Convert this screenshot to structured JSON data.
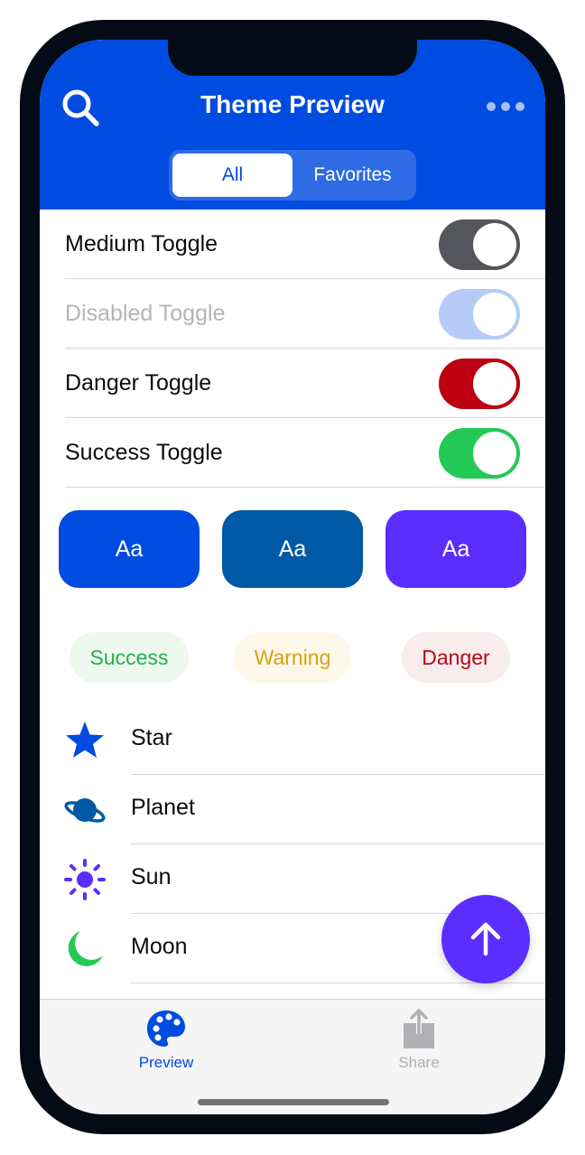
{
  "header": {
    "title": "Theme Preview",
    "segments": [
      {
        "label": "All",
        "active": true
      },
      {
        "label": "Favorites",
        "active": false
      }
    ]
  },
  "toggles": [
    {
      "label": "Medium Toggle",
      "on": true,
      "disabled": false,
      "color": "#55565b"
    },
    {
      "label": "Disabled Toggle",
      "on": true,
      "disabled": true,
      "color": "#b6cbf7"
    },
    {
      "label": "Danger Toggle",
      "on": true,
      "disabled": false,
      "color": "#bc0012"
    },
    {
      "label": "Success Toggle",
      "on": true,
      "disabled": false,
      "color": "#24c955"
    }
  ],
  "swatches": [
    {
      "label": "Aa",
      "color": "#004be0"
    },
    {
      "label": "Aa",
      "color": "#0059a4"
    },
    {
      "label": "Aa",
      "color": "#5c2dff"
    }
  ],
  "badges": [
    {
      "label": "Success",
      "text_color": "#24b04d",
      "bg_color": "#edf9ef"
    },
    {
      "label": "Warning",
      "text_color": "#d8a213",
      "bg_color": "#fdf8e9"
    },
    {
      "label": "Danger",
      "text_color": "#b30a18",
      "bg_color": "#f8ecec"
    }
  ],
  "icon_list": [
    {
      "label": "Star",
      "icon": "star-icon",
      "color": "#004be0"
    },
    {
      "label": "Planet",
      "icon": "planet-icon",
      "color": "#0059a4"
    },
    {
      "label": "Sun",
      "icon": "sun-icon",
      "color": "#5c2dff"
    },
    {
      "label": "Moon",
      "icon": "moon-icon",
      "color": "#24c955"
    }
  ],
  "tabs": [
    {
      "label": "Preview",
      "icon": "palette-icon",
      "active": true
    },
    {
      "label": "Share",
      "icon": "share-icon",
      "active": false
    }
  ],
  "colors": {
    "primary": "#004be0",
    "accent": "#5c2dff",
    "tab_inactive": "#b0b0b4"
  }
}
